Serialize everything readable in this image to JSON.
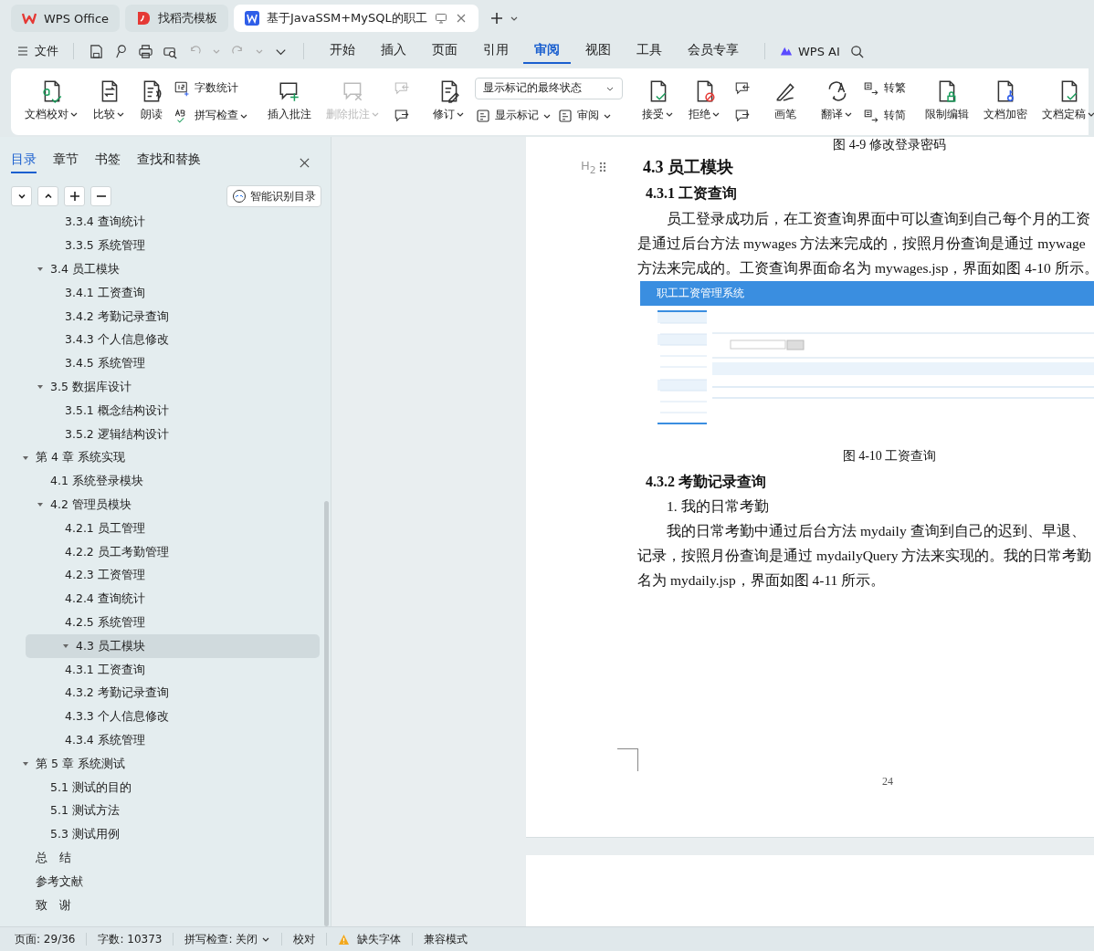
{
  "title_tabs": [
    {
      "kind": "home",
      "label": "WPS Office",
      "selected": false
    },
    {
      "kind": "template",
      "label": "找稻壳模板",
      "selected": false
    },
    {
      "kind": "doc",
      "label": "基于JavaSSM+MySQL的职工",
      "selected": true
    }
  ],
  "menu": {
    "file": "文件",
    "tabs": [
      {
        "label": "开始",
        "selected": false
      },
      {
        "label": "插入",
        "selected": false
      },
      {
        "label": "页面",
        "selected": false
      },
      {
        "label": "引用",
        "selected": false
      },
      {
        "label": "审阅",
        "selected": true
      },
      {
        "label": "视图",
        "selected": false
      },
      {
        "label": "工具",
        "selected": false
      },
      {
        "label": "会员专享",
        "selected": false
      }
    ],
    "ai": "WPS AI"
  },
  "ribbon": [
    {
      "columns": [
        [
          {
            "kind": "big",
            "label": "文档校对",
            "dropdown": true,
            "disabled": false
          }
        ],
        [
          {
            "kind": "big",
            "label": "比较",
            "dropdown": true,
            "disabled": false
          }
        ],
        [
          {
            "kind": "big",
            "label": "朗读",
            "dropdown": false,
            "disabled": false
          }
        ],
        [
          {
            "kind": "small",
            "label": "字数统计",
            "dropdown": false,
            "disabled": false
          },
          {
            "kind": "small",
            "label": "拼写检查",
            "dropdown": true,
            "disabled": false
          }
        ]
      ]
    },
    {
      "columns": [
        [
          {
            "kind": "big",
            "label": "插入批注",
            "dropdown": false,
            "disabled": false
          }
        ],
        [
          {
            "kind": "big",
            "label": "删除批注",
            "dropdown": true,
            "disabled": true
          }
        ],
        [
          {
            "kind": "icon",
            "disabled": true
          },
          {
            "kind": "icon",
            "disabled": false
          }
        ]
      ]
    },
    {
      "columns": [
        [
          {
            "kind": "big",
            "label": "修订",
            "dropdown": true,
            "disabled": false
          }
        ],
        [
          {
            "kind": "select",
            "value": "显示标记的最终状态"
          },
          {
            "kind": "row",
            "items": [
              {
                "label": "显示标记",
                "dropdown": true,
                "disabled": false
              },
              {
                "label": "审阅",
                "dropdown": true,
                "disabled": false
              }
            ]
          }
        ]
      ]
    },
    {
      "columns": [
        [
          {
            "kind": "big",
            "label": "接受",
            "dropdown": true,
            "disabled": false
          }
        ],
        [
          {
            "kind": "big",
            "label": "拒绝",
            "dropdown": true,
            "disabled": false
          }
        ],
        [
          {
            "kind": "icon",
            "disabled": false
          },
          {
            "kind": "icon",
            "disabled": false
          }
        ]
      ]
    },
    {
      "columns": [
        [
          {
            "kind": "big",
            "label": "画笔",
            "dropdown": false,
            "disabled": false
          }
        ]
      ]
    },
    {
      "columns": [
        [
          {
            "kind": "big",
            "label": "翻译",
            "dropdown": true,
            "disabled": false
          }
        ],
        [
          {
            "kind": "small",
            "label": "转繁",
            "dropdown": false,
            "disabled": false
          },
          {
            "kind": "small",
            "label": "转简",
            "dropdown": false,
            "disabled": false
          }
        ]
      ]
    },
    {
      "columns": [
        [
          {
            "kind": "big",
            "label": "限制编辑",
            "dropdown": false,
            "disabled": false
          }
        ],
        [
          {
            "kind": "big",
            "label": "文档加密",
            "dropdown": false,
            "disabled": false
          }
        ],
        [
          {
            "kind": "big",
            "label": "文档定稿",
            "dropdown": true,
            "disabled": false
          }
        ]
      ]
    }
  ],
  "nav_tabs": [
    {
      "label": "目录",
      "selected": true
    },
    {
      "label": "章节",
      "selected": false
    },
    {
      "label": "书签",
      "selected": false
    },
    {
      "label": "查找和替换",
      "selected": false
    }
  ],
  "smart_toc": "智能识别目录",
  "toc": [
    {
      "children": [
        {
          "children": [
            {
              "label": "3.3.4  查询统计",
              "selected": false
            },
            {
              "label": "3.3.5  系统管理",
              "selected": false
            }
          ]
        },
        {
          "label": "3.4  员工模块",
          "selected": false,
          "expanded": true,
          "children": [
            {
              "label": "3.4.1  工资查询",
              "selected": false
            },
            {
              "label": "3.4.2  考勤记录查询",
              "selected": false
            },
            {
              "label": "3.4.3  个人信息修改",
              "selected": false
            },
            {
              "label": "3.4.5  系统管理",
              "selected": false
            }
          ]
        },
        {
          "label": "3.5 数据库设计",
          "selected": false,
          "expanded": true,
          "children": [
            {
              "label": "3.5.1  概念结构设计",
              "selected": false
            },
            {
              "label": "3.5.2  逻辑结构设计",
              "selected": false
            }
          ]
        }
      ]
    },
    {
      "label": "第 4 章  系统实现",
      "selected": false,
      "expanded": true,
      "children": [
        {
          "label": "4.1  系统登录模块",
          "selected": false
        },
        {
          "label": "4.2  管理员模块",
          "selected": false,
          "expanded": true,
          "children": [
            {
              "label": "4.2.1  员工管理",
              "selected": false
            },
            {
              "label": "4.2.2  员工考勤管理",
              "selected": false
            },
            {
              "label": "4.2.3  工资管理",
              "selected": false
            },
            {
              "label": "4.2.4  查询统计",
              "selected": false
            },
            {
              "label": "4.2.5  系统管理",
              "selected": false
            }
          ]
        },
        {
          "label": "4.3  员工模块",
          "selected": true,
          "expanded": true,
          "children": [
            {
              "label": "4.3.1  工资查询",
              "selected": false
            },
            {
              "label": "4.3.2  考勤记录查询",
              "selected": false
            },
            {
              "label": "4.3.3  个人信息修改",
              "selected": false
            },
            {
              "label": "4.3.4  系统管理",
              "selected": false
            }
          ]
        }
      ]
    },
    {
      "label": "第 5 章  系统测试",
      "selected": false,
      "expanded": true,
      "children": [
        {
          "label": "5.1  测试的目的",
          "selected": false
        },
        {
          "label": "5.1  测试方法",
          "selected": false
        },
        {
          "label": "5.3  测试用例",
          "selected": false
        }
      ]
    },
    {
      "label": "总　结",
      "selected": false
    },
    {
      "label": "参考文献",
      "selected": false
    },
    {
      "label": "致　谢",
      "selected": false
    }
  ],
  "document": {
    "blocks": [
      {
        "kind": "caption",
        "text": "图 4-9  修改登录密码"
      },
      {
        "kind": "h2",
        "marker": "H$_{2}$",
        "text": "4.3  员工模块"
      },
      {
        "kind": "h3",
        "text": "4.3.1  工资查询"
      },
      {
        "kind": "para",
        "lines": [
          "员工登录成功后，在工资查询界面中可以查询到自己每个月的工资",
          "是通过后台方法 mywages 方法来完成的，按照月份查询是通过 mywage",
          "方法来完成的。工资查询界面命名为 mywages.jsp，界面如图 4-10 所示。"
        ]
      },
      {
        "kind": "figure",
        "title": "职工工资管理系统"
      },
      {
        "kind": "caption",
        "text": "图 4-10 工资查询"
      },
      {
        "kind": "h3",
        "text": "4.3.2  考勤记录查询"
      },
      {
        "kind": "item",
        "text": "1. 我的日常考勤"
      },
      {
        "kind": "para",
        "lines": [
          "我的日常考勤中通过后台方法 mydaily 查询到自己的迟到、早退、",
          "记录，按照月份查询是通过 mydailyQuery 方法来实现的。我的日常考勤",
          "名为 mydaily.jsp，界面如图 4-11 所示。"
        ]
      }
    ],
    "page_number": "24"
  },
  "status": [
    {
      "kind": "text",
      "label": "页面: 29/36"
    },
    {
      "kind": "text",
      "label": "字数: 10373"
    },
    {
      "kind": "dropdown",
      "label": "拼写检查: 关闭"
    },
    {
      "kind": "text",
      "label": "校对"
    },
    {
      "kind": "warning",
      "label": "缺失字体"
    },
    {
      "kind": "text",
      "label": "兼容模式"
    }
  ]
}
